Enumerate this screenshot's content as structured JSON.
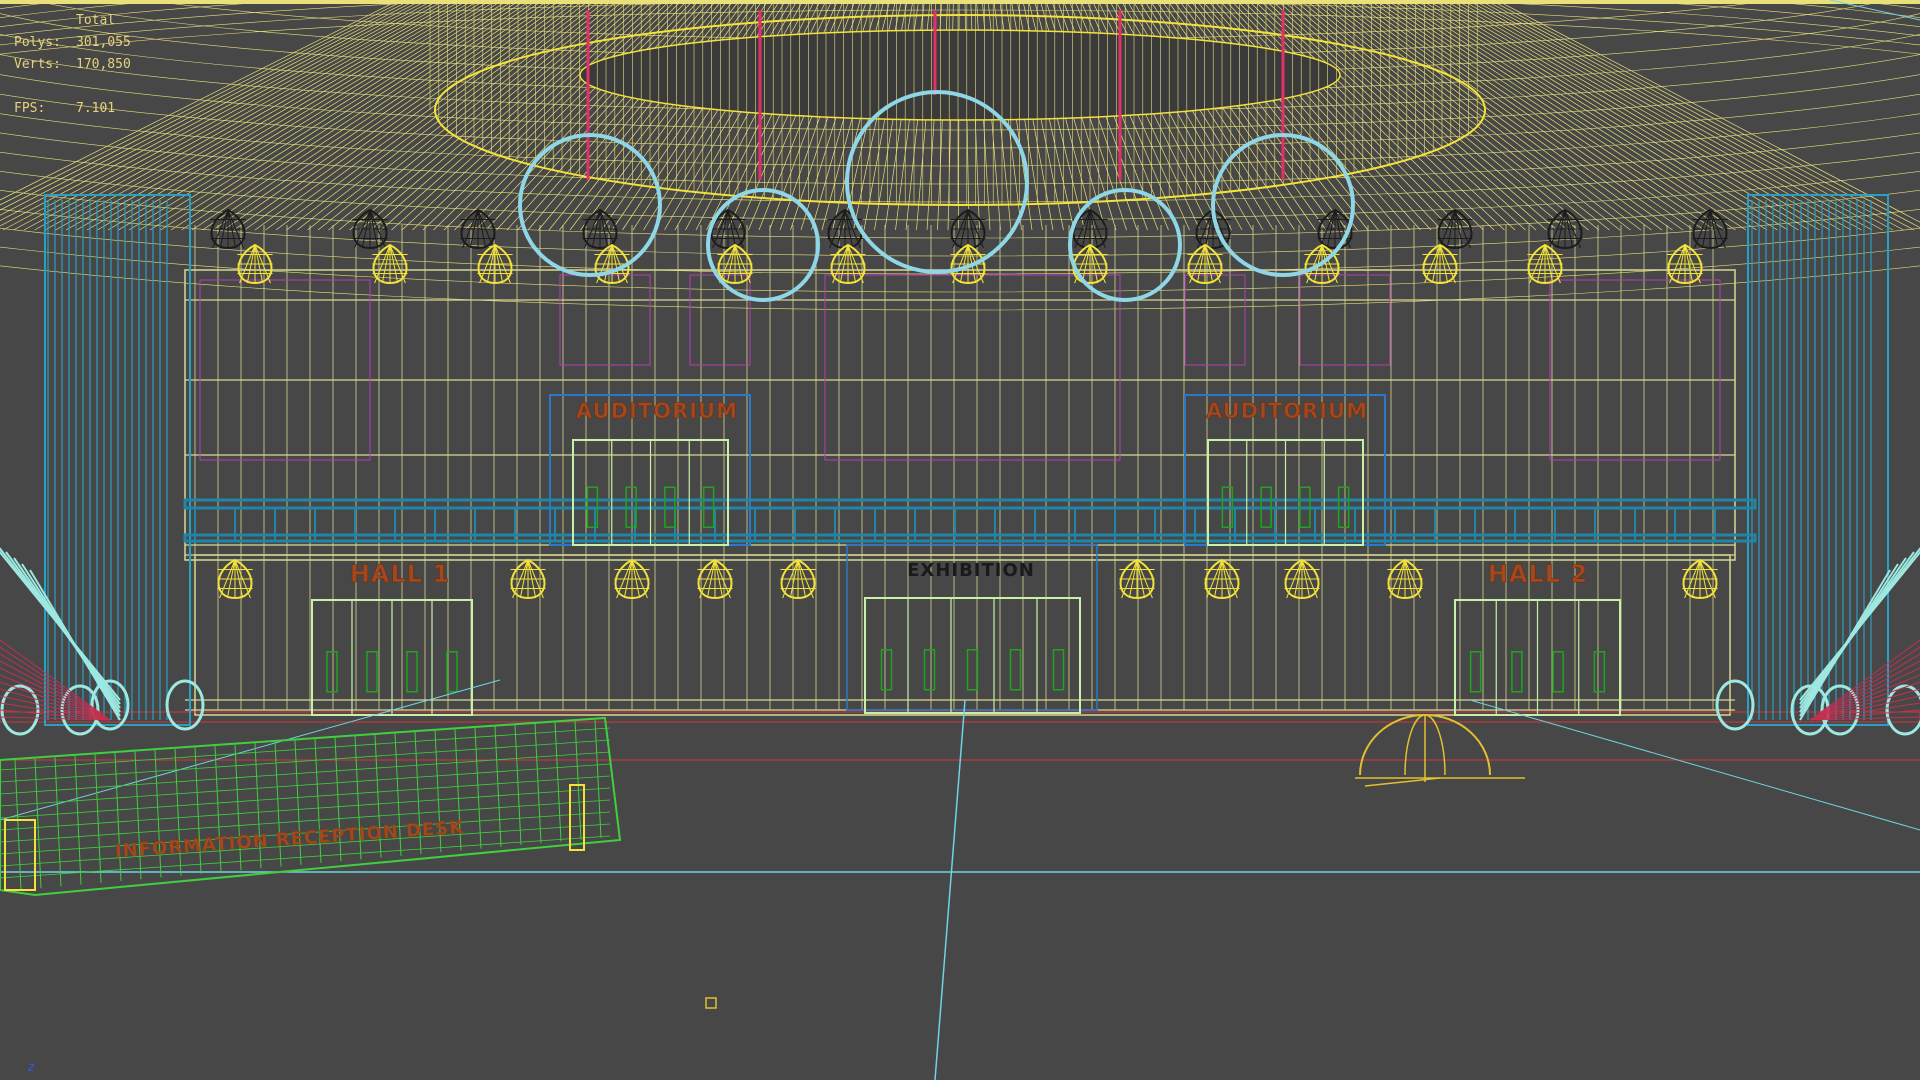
{
  "viewport": {
    "name": "Perspective wireframe viewport",
    "background": "#474747"
  },
  "stats": {
    "header": "Total",
    "rows": [
      {
        "label": "Polys:",
        "value": "301,055"
      },
      {
        "label": "Verts:",
        "value": "170,850"
      },
      {
        "label": "FPS:",
        "value": "7.101"
      }
    ],
    "color": "#e8d37a"
  },
  "signs": {
    "auditorium_left": "AUDITORIUM",
    "auditorium_right": "AUDITORIUM",
    "hall_1": "HALL 1",
    "exhibition": "EXHIBITION",
    "hall_2": "HALL 2",
    "reception": "INFORMATION RECEPTION DESK"
  },
  "colors": {
    "ceiling_wire": "#e9e07a",
    "mullion": "#d8d892",
    "rings": "#8fd6e6",
    "rods": "#e3306a",
    "pendant_yellow": "#f2e23a",
    "pendant_dark": "#1c1c1c",
    "railing": "#1f86a8",
    "columns": "#2a9fc4",
    "doors": "#c8f0a8",
    "door_handles": "#1fa41f",
    "reception_desk": "#3fcf3f",
    "sign_text": "#a2481e",
    "escalator": "#9de8e0",
    "floor_line": "#d2343a",
    "helper_lines": "#6fd3e3",
    "magenta": "#b53cb5"
  },
  "axis_label": "z"
}
